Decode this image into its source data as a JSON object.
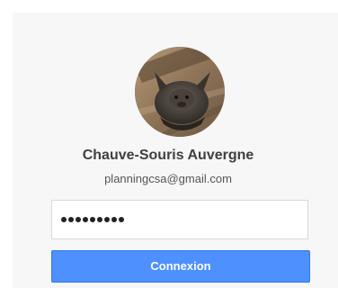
{
  "account": {
    "name": "Chauve-Souris Auvergne",
    "email": "planningcsa@gmail.com",
    "avatar_icon": "bat-photo-avatar"
  },
  "password": {
    "masked_length": 9
  },
  "login_button": {
    "label": "Connexion"
  },
  "colors": {
    "button_bg": "#4d90fe",
    "card_bg": "#f7f7f7"
  }
}
